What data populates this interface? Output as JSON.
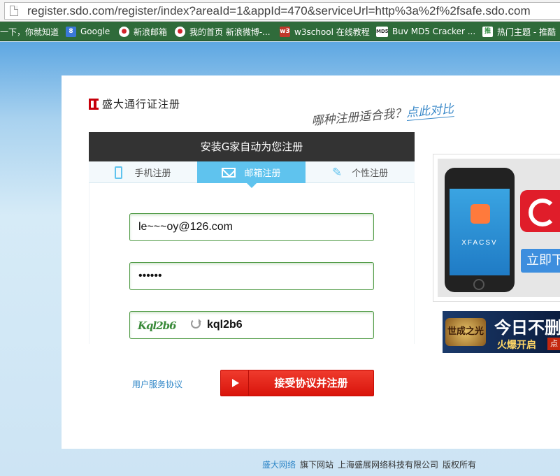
{
  "browser": {
    "url": "register.sdo.com/register/index?areaId=1&appId=470&serviceUrl=http%3a%2f%2fsafe.sdo.com"
  },
  "bookmarks": [
    {
      "label": "一下，你就知道",
      "icon": ""
    },
    {
      "label": "Google",
      "icon": "google-icon"
    },
    {
      "label": "新浪邮箱",
      "icon": "weibo-icon"
    },
    {
      "label": "我的首页 新浪微博-...",
      "icon": "weibo-icon"
    },
    {
      "label": "w3school 在线教程",
      "icon": "w3school-icon"
    },
    {
      "label": "Buv MD5 Cracker ...",
      "icon": "md5-icon"
    },
    {
      "label": "热门主题 - 推酷",
      "icon": "tuicool-icon"
    }
  ],
  "page": {
    "title": "盛大通行证注册",
    "slogan_plain": "哪种注册适合我？",
    "slogan_link": "点此对比",
    "panel_header": "安装G家自动为您注册",
    "tabs": [
      {
        "label": "手机注册",
        "icon": "phone-icon",
        "active": false
      },
      {
        "label": "邮箱注册",
        "icon": "mail-icon",
        "active": true
      },
      {
        "label": "个性注册",
        "icon": "pen-icon",
        "active": false
      }
    ],
    "email_value": "le~~~oy@126.com",
    "password_value": "••••••",
    "captcha_image_text": "Kql2b6",
    "captcha_value": "kql2b6",
    "agreement_link": "用户服务协议",
    "submit_label": "接受协议并注册"
  },
  "ads": {
    "app_name": "XFACSV",
    "download_label": "立即下",
    "game_logo": "世成之光",
    "game_title": "今日不删",
    "game_subtitle": "火爆开启",
    "game_badge": "点"
  },
  "footer": {
    "brand": "盛大网络",
    "site": "旗下网站",
    "company": "上海盛展网络科技有限公司",
    "rights": "版权所有"
  },
  "colors": {
    "accent": "#5fc3ee",
    "button": "#d9140b",
    "header": "#333333",
    "link": "#2f86c7"
  }
}
